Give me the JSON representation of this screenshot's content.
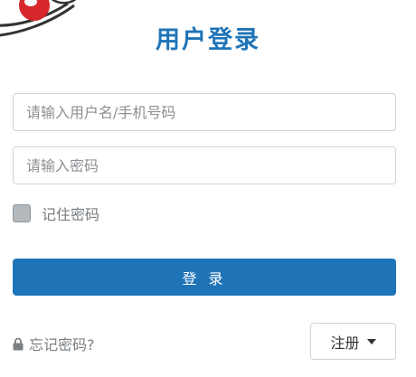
{
  "header": {
    "title": "用户登录"
  },
  "form": {
    "username_placeholder": "请输入用户名/手机号码",
    "username_value": "",
    "password_placeholder": "请输入密码",
    "password_value": "",
    "remember_label": "记住密码",
    "remember_checked": false,
    "login_label": "登 录"
  },
  "footer": {
    "forgot_label": "忘记密码?",
    "register_label": "注册"
  },
  "icons": {
    "lock": "lock-icon",
    "caret": "caret-down-icon",
    "logo": "logo-icon"
  },
  "colors": {
    "accent": "#1f74b8",
    "logo_red": "#d7262b"
  }
}
